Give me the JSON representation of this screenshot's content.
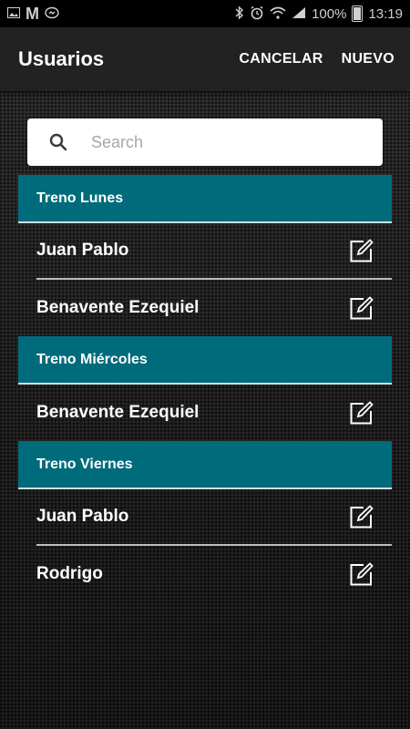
{
  "status_bar": {
    "left_icons": [
      "image-icon",
      "gmail-icon",
      "messenger-icon"
    ],
    "right_icons": [
      "bluetooth-icon",
      "alarm-icon",
      "wifi-icon",
      "signal-icon",
      "battery-icon"
    ],
    "battery": "100%",
    "time": "13:19"
  },
  "appbar": {
    "title": "Usuarios",
    "cancel_label": "CANCELAR",
    "new_label": "NUEVO"
  },
  "search": {
    "placeholder": "Search",
    "value": ""
  },
  "groups": [
    {
      "header": "Treno Lunes",
      "items": [
        "Juan Pablo",
        "Benavente Ezequiel"
      ]
    },
    {
      "header": "Treno Miércoles",
      "items": [
        "Benavente Ezequiel"
      ]
    },
    {
      "header": "Treno Viernes",
      "items": [
        "Juan Pablo",
        "Rodrigo"
      ]
    }
  ],
  "colors": {
    "group_header": "#006b7b",
    "appbar": "#222222",
    "background": "#1f1f1f"
  }
}
